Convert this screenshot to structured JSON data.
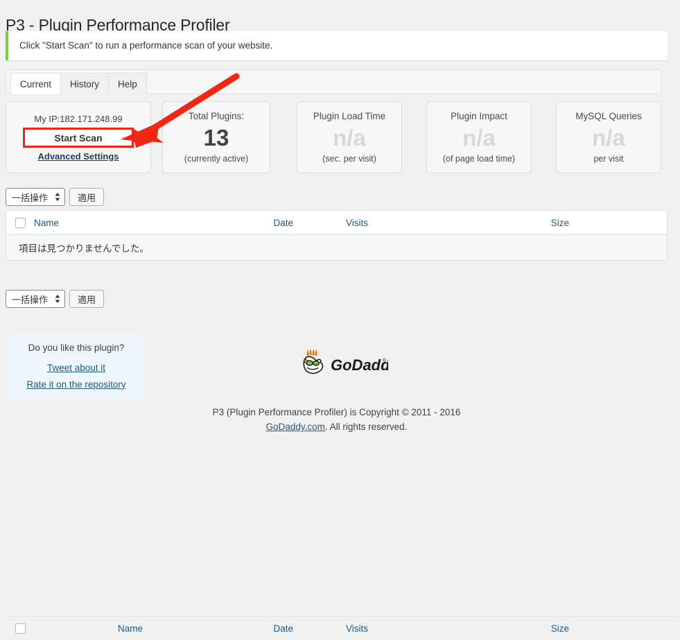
{
  "page": {
    "title": "P3 - Plugin Performance Profiler",
    "notice": "Click \"Start Scan\" to run a performance scan of your website."
  },
  "tabs": [
    {
      "label": "Current",
      "active": true
    },
    {
      "label": "History",
      "active": false
    },
    {
      "label": "Help",
      "active": false
    }
  ],
  "scan_card": {
    "ip_label": "My IP:182.171.248.99",
    "start_scan_label": "Start Scan",
    "advanced_settings_label": "Advanced Settings"
  },
  "stats": [
    {
      "label": "Total Plugins:",
      "value": "13",
      "sub": "(currently active)",
      "na": false
    },
    {
      "label": "Plugin Load Time",
      "value": "n/a",
      "sub": "(sec. per visit)",
      "na": true
    },
    {
      "label": "Plugin Impact",
      "value": "n/a",
      "sub": "(of page load time)",
      "na": true
    },
    {
      "label": "MySQL Queries",
      "value": "n/a",
      "sub": "per visit",
      "na": true
    }
  ],
  "bulk": {
    "select_value": "一括操作",
    "apply_label": "適用"
  },
  "table": {
    "columns": {
      "name": "Name",
      "date": "Date",
      "visits": "Visits",
      "size": "Size"
    },
    "empty_message": "項目は見つかりませんでした。"
  },
  "like_box": {
    "title": "Do you like this plugin?",
    "tweet_label": "Tweet about it",
    "rate_label": "Rate it on the repository"
  },
  "logo": {
    "name": "godaddy-logo",
    "wordmark": "GoDaddy",
    "trademark": "®"
  },
  "footer": {
    "line1": "P3 (Plugin Performance Profiler) is Copyright © 2011 - 2016",
    "link": "GoDaddy.com",
    "line2": ". All rights reserved."
  },
  "annotation": {
    "arrow_color": "#f22613",
    "highlight_color": "#f22613"
  }
}
